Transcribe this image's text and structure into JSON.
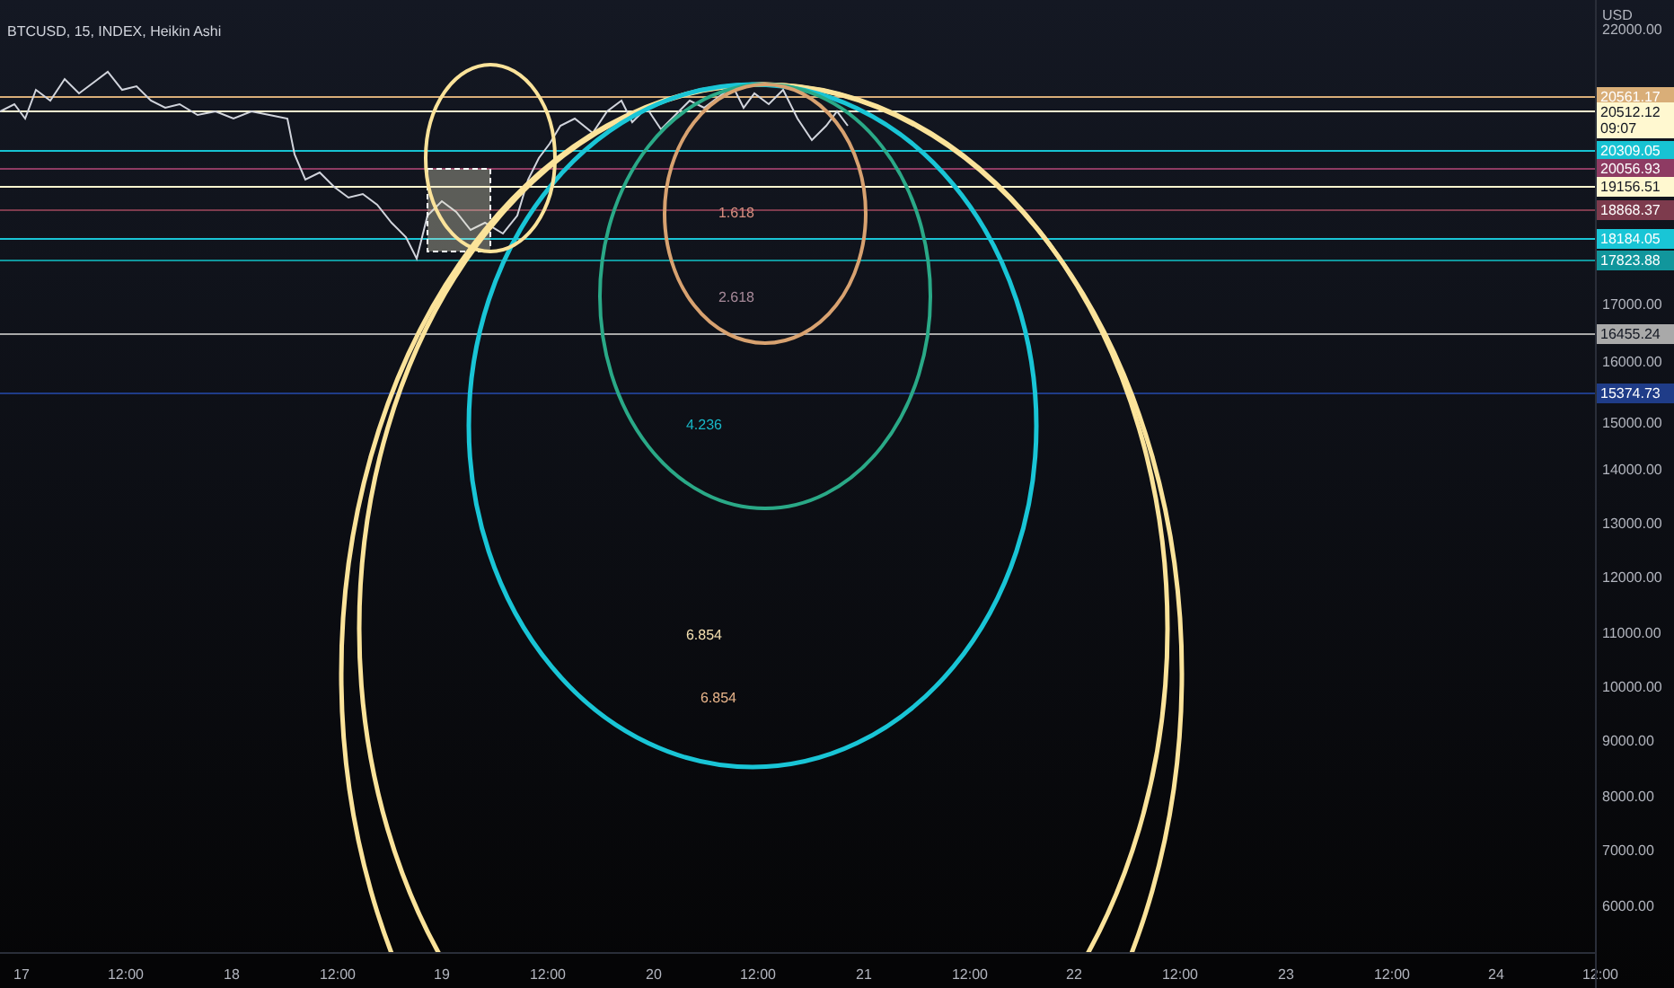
{
  "title": "BTCUSD, 15, INDEX, Heikin Ashi",
  "price_axis": {
    "unit": "USD",
    "ticks": [
      "22000.00",
      "17000.00",
      "16000.00",
      "15000.00",
      "14000.00",
      "13000.00",
      "12000.00",
      "11000.00",
      "10000.00",
      "9000.00",
      "8000.00",
      "7000.00",
      "6000.00"
    ]
  },
  "price_labels": [
    {
      "text": "20561.17",
      "color": "#d9ae78"
    },
    {
      "text": "20512.12",
      "sub": "09:07",
      "color": "#fff8d0"
    },
    {
      "text": "20309.05",
      "color": "#17c3d3"
    },
    {
      "text": "20056.93",
      "color": "#8e3b63"
    },
    {
      "text": "19156.51",
      "color": "#fff8d0"
    },
    {
      "text": "18868.37",
      "color": "#7d3b4d"
    },
    {
      "text": "18184.05",
      "color": "#19c5d6"
    },
    {
      "text": "17823.88",
      "color": "#11969c"
    },
    {
      "text": "16455.24",
      "color": "#a9a9a9"
    },
    {
      "text": "15374.73",
      "color": "#1f3c88"
    }
  ],
  "fib_labels": [
    {
      "text": "1.618",
      "color": "#d98f80"
    },
    {
      "text": "2.618",
      "color": "#a88a9a"
    },
    {
      "text": "4.236",
      "color": "#18b8c8"
    },
    {
      "text": "6.854",
      "color": "#f4e0b0"
    },
    {
      "text": "6.854",
      "color": "#e8b48a"
    }
  ],
  "time_axis": [
    "17",
    "12:00",
    "18",
    "12:00",
    "19",
    "12:00",
    "20",
    "12:00",
    "21",
    "12:00",
    "22",
    "12:00",
    "23",
    "12:00",
    "24",
    "12:00"
  ]
}
